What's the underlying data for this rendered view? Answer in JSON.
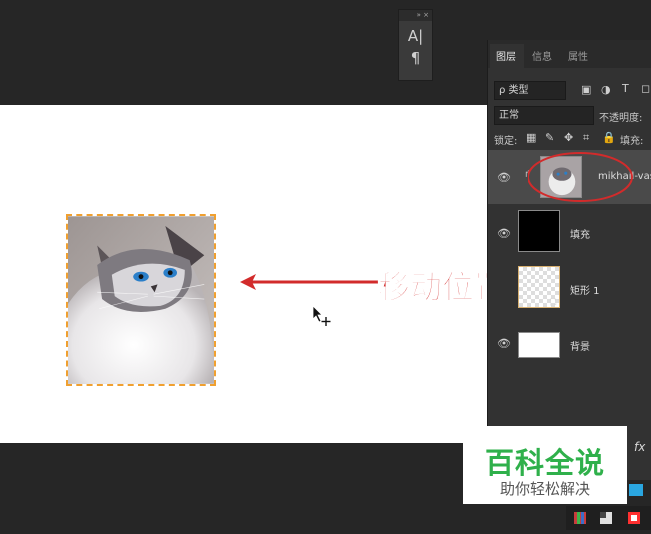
{
  "char_panel": {
    "collapse_glyph": "»",
    "close_glyph": "×",
    "char_icon": "A|",
    "para_icon": "¶"
  },
  "layers_panel": {
    "tabs": [
      "图层",
      "信息",
      "属性"
    ],
    "filter_label": "ρ 类型",
    "blend_mode": "正常",
    "opacity_label": "不透明度:",
    "lock_label": "锁定:",
    "fill_label": "填充:",
    "layers": [
      {
        "name": "mikhail-vasi",
        "thumb": "cat-photo"
      },
      {
        "name": "填充",
        "thumb": "black"
      },
      {
        "name": "矩形 1",
        "thumb": "transparent"
      },
      {
        "name": "背景",
        "thumb": "white"
      }
    ],
    "fx_label": "fx"
  },
  "annotation": {
    "text": "移动位置",
    "color": "#d22b2b"
  },
  "watermark": {
    "title": "百科全说",
    "subtitle": "助你轻松解决",
    "color": "#2fb04b"
  }
}
